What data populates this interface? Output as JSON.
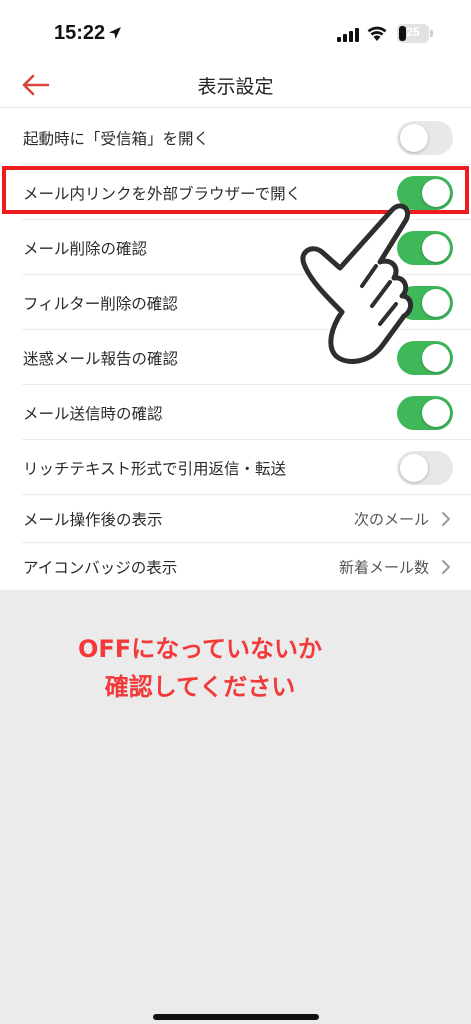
{
  "status_bar": {
    "time": "15:22",
    "battery": "25",
    "battery_level": 0.25
  },
  "nav": {
    "title": "表示設定",
    "back_icon": "back-arrow-icon"
  },
  "settings": {
    "startup_inbox": {
      "label": "起動時に「受信箱」を開く",
      "state": "off"
    },
    "external_browser": {
      "label": "メール内リンクを外部ブラウザーで開く",
      "state": "on"
    },
    "delete_confirm": {
      "label": "メール削除の確認",
      "state": "on"
    },
    "filter_delete_confirm": {
      "label": "フィルター削除の確認",
      "state": "on"
    },
    "spam_report_confirm": {
      "label": "迷惑メール報告の確認",
      "state": "on"
    },
    "send_confirm": {
      "label": "メール送信時の確認",
      "state": "on"
    },
    "rich_text_quote": {
      "label": "リッチテキスト形式で引用返信・転送",
      "state": "off"
    },
    "after_action_display": {
      "label": "メール操作後の表示",
      "value": "次のメール"
    },
    "icon_badge": {
      "label": "アイコンバッジの表示",
      "value": "新着メール数"
    }
  },
  "annotation": {
    "line1": "OFFになっていないか",
    "line2": "確認してください"
  },
  "colors": {
    "accent_red": "#d9453e",
    "toggle_on": "#3fb85a",
    "toggle_off": "#e8e8ea",
    "highlight": "#ee1c1c",
    "annotation_text": "#f23a3a"
  }
}
